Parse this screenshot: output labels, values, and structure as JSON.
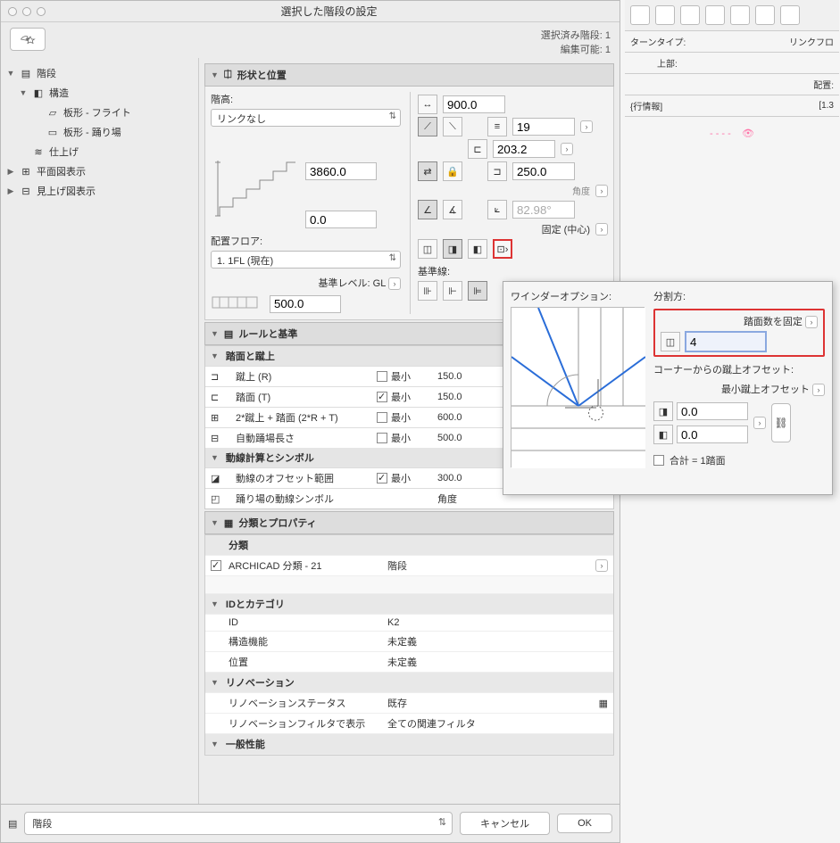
{
  "dialog": {
    "title": "選択した階段の設定",
    "selected_label": "選択済み階段:",
    "selected_count": "1",
    "editable_label": "編集可能:",
    "editable_count": "1"
  },
  "sidebar": {
    "root": "階段",
    "structure": "構造",
    "flight": "板形 - フライト",
    "landing": "板形 - 踊り場",
    "finish": "仕上げ",
    "plan": "平面図表示",
    "elev": "見上げ図表示"
  },
  "section_shape": {
    "title": "形状と位置",
    "floor_height_label": "階高:",
    "link_none": "リンクなし",
    "height_top": "3860.0",
    "height_bottom": "0.0",
    "placement_floor_label": "配置フロア:",
    "placement_floor": "1. 1FL (現在)",
    "base_level_label": "基準レベル: GL",
    "base_level": "500.0",
    "width": "900.0",
    "risers": "19",
    "tread_depth": "203.2",
    "riser_height": "250.0",
    "angle_label": "角度",
    "angle_value": "82.98°",
    "fixed_center": "固定 (中心)",
    "baseline_label": "基準線:"
  },
  "section_rules": {
    "title": "ルールと基準",
    "sub1": "踏面と蹴上",
    "riser_label": "蹴上 (R)",
    "tread_label": "踏面 (T)",
    "rule2r_label": "2*蹴上 + 踏面 (2*R + T)",
    "auto_landing": "自動踊場長さ",
    "min_label": "最小",
    "val_riser": "150.0",
    "val_tread": "150.0",
    "val_2r": "600.0",
    "val_landing": "500.0",
    "sub2": "動線計算とシンボル",
    "walkline_offset": "動線のオフセット範囲",
    "val_walkline": "300.0",
    "landing_symbol": "踊り場の動線シンボル",
    "angle": "角度"
  },
  "section_class": {
    "title": "分類とプロパティ",
    "classify_hdr": "分類",
    "classify_name": "ARCHICAD 分類 - 21",
    "classify_val": "階段",
    "id_category": "IDとカテゴリ",
    "id_label": "ID",
    "id_val": "K2",
    "struct_fn": "構造機能",
    "undefined": "未定義",
    "position": "位置",
    "renovation": "リノベーション",
    "reno_status": "リノベーションステータス",
    "existing": "既存",
    "reno_filter": "リノベーションフィルタで表示",
    "all_filters": "全ての関連フィルタ",
    "general": "一般性能"
  },
  "footer": {
    "selector": "階段",
    "cancel": "キャンセル",
    "ok": "OK"
  },
  "popup": {
    "winder_label": "ワインダーオプション:",
    "division_label": "分割方:",
    "fixed_tread": "踏面数を固定",
    "count": "4",
    "corner_offset_label": "コーナーからの蹴上オフセット:",
    "min_riser_offset": "最小蹴上オフセット",
    "offset1": "0.0",
    "offset2": "0.0",
    "total_label": "合計 = 1踏面"
  },
  "bg": {
    "turn_type": "ターンタイプ:",
    "top": "上部:",
    "place": "配置:",
    "link_floor": "リンクフロ",
    "info": "{行情報]",
    "mark": "[1.3"
  }
}
